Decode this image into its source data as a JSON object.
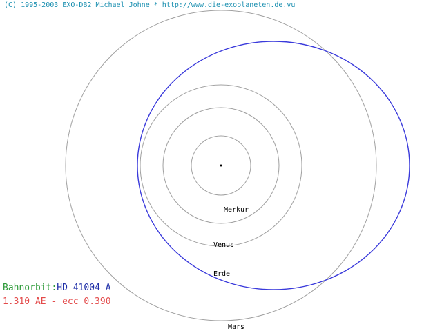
{
  "header": {
    "copyright": "(C) 1995-2003 EXO-DB2 Michael Johne * http://www.die-exoplaneten.de.vu"
  },
  "orbits": [
    {
      "name": "Merkur"
    },
    {
      "name": "Venus"
    },
    {
      "name": "Erde"
    },
    {
      "name": "Mars"
    }
  ],
  "planet_orbit": {
    "semi_major_axis_au": 1.31,
    "eccentricity": 0.39,
    "color": "#3a3adb"
  },
  "colors": {
    "reference_orbit": "#a0a0a0",
    "star": "#000000"
  },
  "info": {
    "orbit_label": "Bahnorbit:",
    "object_name": "HD 41004 A",
    "parameters": "1.310 AE - ecc 0.390"
  }
}
